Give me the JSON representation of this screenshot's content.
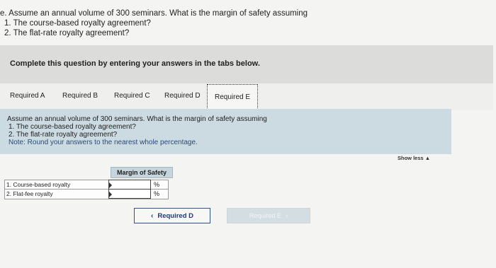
{
  "question": {
    "lead": "e. Assume an annual volume of 300 seminars. What is the margin of safety assuming",
    "items": [
      "1. The course-based royalty agreement?",
      "2. The flat-rate royalty agreement?"
    ]
  },
  "instruction": "Complete this question by entering your answers in the tabs below.",
  "tabs": [
    {
      "label": "Required A"
    },
    {
      "label": "Required B"
    },
    {
      "label": "Required C"
    },
    {
      "label": "Required D"
    },
    {
      "label": "Required E",
      "active": true
    }
  ],
  "panel": {
    "lead": "Assume an annual volume of 300 seminars. What is the margin of safety assuming",
    "items": [
      "1. The course-based royalty agreement?",
      "2. The flat-rate royalty agreement?"
    ],
    "note": "Note: Round your answers to the nearest whole percentage."
  },
  "show_less": "Show less ▲",
  "answer_table": {
    "header": "Margin of Safety",
    "rows": [
      {
        "label": "1. Course-based royalty",
        "value": "",
        "unit": "%"
      },
      {
        "label": "2. Flat-fee royalty",
        "value": "",
        "unit": "%"
      }
    ]
  },
  "nav": {
    "prev_label": "Required D",
    "next_label": "Required E",
    "prev_icon": "chevron-left-icon",
    "next_icon": "chevron-right-icon"
  },
  "colors": {
    "panel_bg": "#cbdbe1",
    "nav_accent": "#1e3a78",
    "instruction_bg": "#dcdcda"
  }
}
